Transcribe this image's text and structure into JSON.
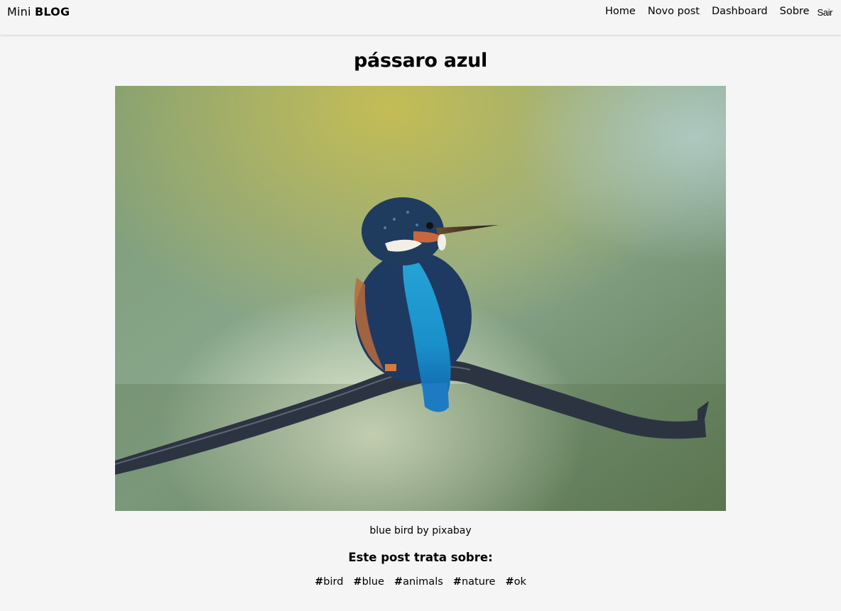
{
  "navbar": {
    "brand_prefix": "Mini",
    "brand_strong": "BLOG",
    "links": {
      "home": "Home",
      "new_post": "Novo post",
      "dashboard": "Dashboard",
      "about": "Sobre",
      "logout": "Sair"
    }
  },
  "post": {
    "title": "pássaro azul",
    "image_subject": "kingfisher-perched-on-branch",
    "body": "blue bird by pixabay",
    "tags_title": "Este post trata sobre:",
    "tags": [
      "bird",
      "blue",
      "animals",
      "nature",
      "ok"
    ]
  }
}
